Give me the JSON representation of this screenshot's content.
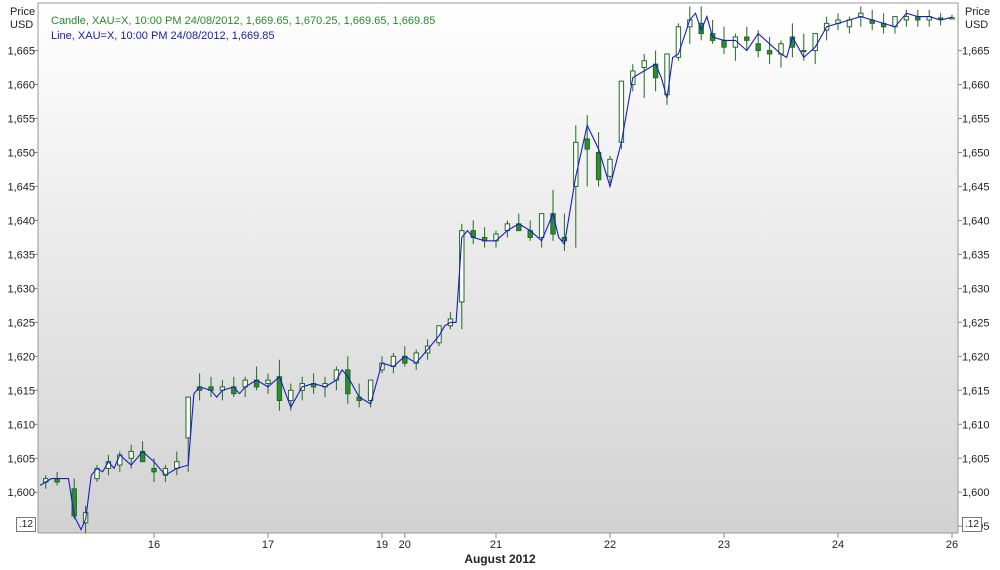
{
  "legend": {
    "candle": "Candle, XAU=X, 10:00 PM 24/08/2012, 1,669.65, 1,670.25, 1,669.65, 1,669.85",
    "line": "Line, XAU=X, 10:00 PM 24/08/2012, 1,669.85"
  },
  "axes": {
    "left_unit_top": "Price",
    "left_unit_bottom": "USD",
    "right_unit_top": "Price",
    "right_unit_bottom": "USD",
    "badge_left": ".12",
    "badge_right": ".12",
    "month_label": "August 2012"
  },
  "colors": {
    "candle_up": "#2e8b2e",
    "candle_outline": "#1f6b1f",
    "line": "#1a1acc",
    "legend_candle": "#2a8a2a",
    "legend_line": "#1a1aaa",
    "axis": "#888888"
  },
  "chart_data": {
    "type": "line",
    "y_ticks_left": [
      "1,600",
      "1,605",
      "1,610",
      "1,615",
      "1,620",
      "1,625",
      "1,630",
      "1,635",
      "1,640",
      "1,645",
      "1,650",
      "1,655",
      "1,660",
      "1,665"
    ],
    "y_ticks_right": [
      "1,595",
      "1,600",
      "1,605",
      "1,610",
      "1,615",
      "1,620",
      "1,625",
      "1,630",
      "1,635",
      "1,640",
      "1,645",
      "1,650",
      "1,655",
      "1,660",
      "1,665"
    ],
    "ylim": [
      1594,
      1672
    ],
    "x_labels": [
      "16",
      "17",
      "19",
      "20",
      "21",
      "22",
      "23",
      "24",
      "26"
    ],
    "x_label_positions": [
      1.0,
      2.0,
      3.0,
      3.2,
      4.0,
      5.0,
      6.0,
      7.0,
      8.0
    ],
    "xlim": [
      0,
      8.0
    ],
    "series": [
      {
        "name": "Line",
        "x": [
          0.0,
          0.1,
          0.25,
          0.3,
          0.36,
          0.4,
          0.45,
          0.5,
          0.55,
          0.6,
          0.65,
          0.7,
          0.8,
          0.9,
          1.0,
          1.1,
          1.2,
          1.3,
          1.35,
          1.4,
          1.5,
          1.55,
          1.6,
          1.7,
          1.75,
          1.8,
          1.9,
          2.0,
          2.1,
          2.2,
          2.3,
          2.4,
          2.5,
          2.55,
          2.6,
          2.65,
          2.7,
          2.8,
          2.9,
          3.0,
          3.1,
          3.2,
          3.3,
          3.4,
          3.5,
          3.55,
          3.6,
          3.65,
          3.7,
          3.75,
          3.8,
          3.9,
          4.0,
          4.1,
          4.2,
          4.3,
          4.4,
          4.5,
          4.55,
          4.6,
          4.7,
          4.8,
          4.9,
          5.0,
          5.1,
          5.2,
          5.3,
          5.4,
          5.45,
          5.5,
          5.55,
          5.6,
          5.7,
          5.75,
          5.8,
          5.85,
          5.9,
          6.0,
          6.1,
          6.2,
          6.3,
          6.4,
          6.5,
          6.55,
          6.6,
          6.65,
          6.7,
          6.8,
          6.9,
          7.0,
          7.1,
          7.2,
          7.3,
          7.4,
          7.5,
          7.6,
          7.7,
          7.8,
          7.9,
          8.0
        ],
        "values": [
          1601.0,
          1602.0,
          1602.0,
          1596.5,
          1594.5,
          1596.0,
          1602.5,
          1603.5,
          1603.0,
          1604.5,
          1603.5,
          1605.5,
          1604.0,
          1606.0,
          1604.5,
          1602.5,
          1603.5,
          1604.0,
          1614.5,
          1615.5,
          1615.0,
          1614.0,
          1615.0,
          1615.5,
          1614.5,
          1615.5,
          1616.5,
          1615.5,
          1617.0,
          1612.5,
          1615.5,
          1616.0,
          1615.5,
          1616.0,
          1616.5,
          1618.0,
          1617.0,
          1614.0,
          1613.0,
          1619.0,
          1618.5,
          1620.0,
          1619.0,
          1621.0,
          1623.0,
          1624.5,
          1625.0,
          1625.0,
          1637.5,
          1638.5,
          1637.5,
          1637.0,
          1637.0,
          1638.5,
          1639.5,
          1638.5,
          1637.0,
          1641.0,
          1637.5,
          1636.5,
          1646.5,
          1654.0,
          1650.5,
          1645.0,
          1651.5,
          1661.0,
          1662.0,
          1663.0,
          1661.0,
          1658.0,
          1664.0,
          1664.5,
          1669.5,
          1670.5,
          1668.0,
          1670.0,
          1667.0,
          1666.5,
          1666.5,
          1665.0,
          1667.5,
          1666.0,
          1664.5,
          1664.0,
          1667.0,
          1665.5,
          1664.0,
          1665.5,
          1668.5,
          1669.0,
          1669.5,
          1670.0,
          1669.5,
          1669.0,
          1668.5,
          1670.5,
          1670.0,
          1670.0,
          1669.5,
          1669.9
        ]
      },
      {
        "name": "Candle",
        "x": [
          0.05,
          0.15,
          0.3,
          0.4,
          0.5,
          0.6,
          0.7,
          0.8,
          0.9,
          1.0,
          1.1,
          1.2,
          1.3,
          1.4,
          1.5,
          1.6,
          1.7,
          1.8,
          1.9,
          2.0,
          2.1,
          2.2,
          2.3,
          2.4,
          2.5,
          2.6,
          2.7,
          2.8,
          2.9,
          3.0,
          3.1,
          3.2,
          3.3,
          3.4,
          3.5,
          3.6,
          3.7,
          3.8,
          3.9,
          4.0,
          4.1,
          4.2,
          4.3,
          4.4,
          4.5,
          4.6,
          4.7,
          4.8,
          4.9,
          5.0,
          5.1,
          5.2,
          5.3,
          5.4,
          5.5,
          5.6,
          5.7,
          5.8,
          5.9,
          6.0,
          6.1,
          6.2,
          6.3,
          6.4,
          6.5,
          6.6,
          6.7,
          6.8,
          6.9,
          7.0,
          7.1,
          7.2,
          7.3,
          7.4,
          7.5,
          7.6,
          7.7,
          7.8,
          7.9,
          8.0
        ],
        "open": [
          1601.5,
          1602.0,
          1600.5,
          1595.5,
          1602.0,
          1603.5,
          1604.0,
          1605.0,
          1606.0,
          1603.5,
          1602.5,
          1603.5,
          1608.0,
          1615.5,
          1615.5,
          1615.0,
          1615.5,
          1615.5,
          1616.5,
          1616.0,
          1617.0,
          1613.5,
          1615.0,
          1616.0,
          1615.5,
          1616.5,
          1618.0,
          1614.0,
          1613.5,
          1618.0,
          1618.5,
          1620.0,
          1619.0,
          1620.5,
          1622.0,
          1624.5,
          1628.0,
          1638.5,
          1637.5,
          1637.0,
          1638.5,
          1639.5,
          1638.5,
          1637.5,
          1641.0,
          1637.5,
          1645.0,
          1652.0,
          1650.0,
          1646.5,
          1651.5,
          1660.0,
          1662.5,
          1663.0,
          1658.5,
          1664.0,
          1668.5,
          1669.0,
          1667.5,
          1666.5,
          1665.5,
          1667.0,
          1666.0,
          1665.0,
          1664.5,
          1667.0,
          1665.0,
          1665.0,
          1668.0,
          1669.0,
          1668.5,
          1670.0,
          1669.5,
          1669.0,
          1668.5,
          1669.5,
          1670.0,
          1669.5,
          1669.7,
          1669.65
        ],
        "high": [
          1602.5,
          1603.0,
          1602.0,
          1598.0,
          1604.0,
          1605.5,
          1606.0,
          1607.0,
          1607.5,
          1605.0,
          1604.0,
          1606.0,
          1611.0,
          1617.5,
          1617.0,
          1616.5,
          1617.0,
          1617.0,
          1618.5,
          1617.5,
          1619.5,
          1616.0,
          1617.0,
          1617.5,
          1617.0,
          1618.5,
          1620.0,
          1616.0,
          1615.5,
          1620.0,
          1620.5,
          1621.5,
          1621.0,
          1622.5,
          1624.0,
          1626.5,
          1639.5,
          1640.0,
          1639.0,
          1638.5,
          1640.0,
          1641.0,
          1640.0,
          1639.0,
          1644.5,
          1641.0,
          1654.0,
          1655.5,
          1653.0,
          1649.5,
          1654.0,
          1663.0,
          1664.5,
          1665.0,
          1663.0,
          1669.0,
          1671.5,
          1671.5,
          1669.5,
          1668.5,
          1667.5,
          1668.5,
          1668.0,
          1667.0,
          1666.5,
          1669.0,
          1667.5,
          1667.0,
          1670.0,
          1670.5,
          1670.0,
          1671.5,
          1671.0,
          1670.5,
          1670.0,
          1671.0,
          1671.0,
          1671.0,
          1670.5,
          1670.25
        ],
        "low": [
          1600.5,
          1601.0,
          1596.0,
          1594.0,
          1601.5,
          1602.5,
          1603.0,
          1603.5,
          1604.5,
          1601.5,
          1601.5,
          1602.5,
          1603.0,
          1613.5,
          1614.0,
          1613.5,
          1614.0,
          1614.0,
          1615.0,
          1614.5,
          1612.0,
          1612.0,
          1613.5,
          1614.5,
          1614.0,
          1615.0,
          1613.0,
          1612.5,
          1612.5,
          1617.5,
          1617.5,
          1618.5,
          1618.0,
          1619.5,
          1621.5,
          1624.0,
          1624.0,
          1636.5,
          1636.0,
          1636.0,
          1637.5,
          1638.5,
          1637.0,
          1636.0,
          1637.0,
          1635.5,
          1636.0,
          1645.0,
          1645.0,
          1645.5,
          1650.5,
          1659.0,
          1658.0,
          1659.0,
          1657.0,
          1663.5,
          1666.0,
          1666.5,
          1666.0,
          1664.5,
          1663.5,
          1665.0,
          1664.0,
          1663.0,
          1662.5,
          1664.0,
          1663.5,
          1663.0,
          1666.5,
          1668.0,
          1667.5,
          1668.5,
          1668.0,
          1667.5,
          1667.5,
          1668.5,
          1668.5,
          1668.5,
          1668.7,
          1669.65
        ],
        "close": [
          1602.0,
          1601.5,
          1596.5,
          1597.0,
          1603.5,
          1604.5,
          1605.5,
          1606.0,
          1604.5,
          1603.0,
          1603.5,
          1604.5,
          1614.0,
          1615.0,
          1615.0,
          1615.5,
          1614.5,
          1616.5,
          1615.5,
          1616.5,
          1613.5,
          1615.0,
          1616.0,
          1615.5,
          1616.0,
          1618.0,
          1614.5,
          1613.5,
          1616.5,
          1619.0,
          1620.0,
          1619.0,
          1620.5,
          1621.5,
          1624.5,
          1625.5,
          1638.5,
          1637.5,
          1637.0,
          1638.0,
          1639.5,
          1638.5,
          1637.5,
          1641.0,
          1638.0,
          1637.0,
          1651.5,
          1650.5,
          1646.0,
          1649.0,
          1660.5,
          1662.0,
          1663.5,
          1661.0,
          1664.5,
          1668.5,
          1669.5,
          1667.5,
          1666.5,
          1665.5,
          1667.0,
          1666.5,
          1665.0,
          1664.5,
          1666.0,
          1665.5,
          1665.0,
          1667.5,
          1669.0,
          1669.5,
          1669.5,
          1670.5,
          1669.0,
          1668.5,
          1670.0,
          1670.0,
          1669.5,
          1670.0,
          1669.8,
          1669.85
        ]
      }
    ]
  }
}
